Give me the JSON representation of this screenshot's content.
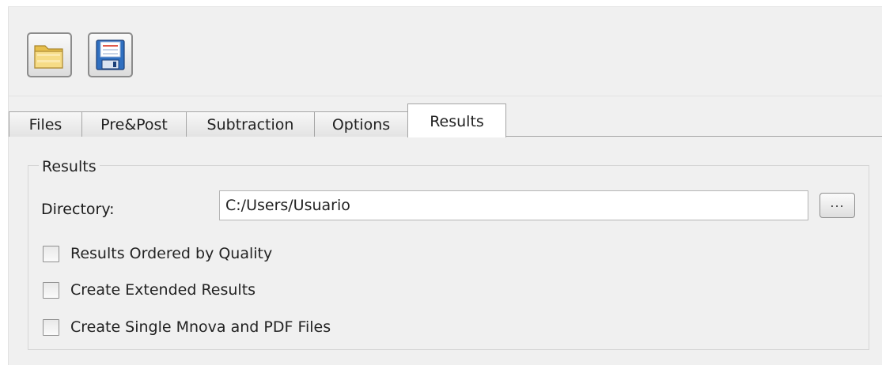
{
  "toolbar": {
    "open_icon": "folder-open-icon",
    "save_icon": "floppy-save-icon"
  },
  "tabs": [
    {
      "label": "Files"
    },
    {
      "label": "Pre&Post"
    },
    {
      "label": "Subtraction"
    },
    {
      "label": "Options"
    },
    {
      "label": "Results",
      "active": true
    }
  ],
  "results": {
    "group_title": "Results",
    "directory_label": "Directory:",
    "directory_value": "C:/Users/Usuario",
    "browse_label": "...",
    "options": [
      {
        "label": "Results Ordered by Quality",
        "checked": false
      },
      {
        "label": "Create Extended Results",
        "checked": false
      },
      {
        "label": "Create Single Mnova and PDF Files",
        "checked": false
      }
    ]
  },
  "colors": {
    "window_bg": "#f0f0f0",
    "tab_border": "#a5a5a5",
    "folder_yellow": "#f3d36a",
    "floppy_blue": "#2f6fc0"
  }
}
